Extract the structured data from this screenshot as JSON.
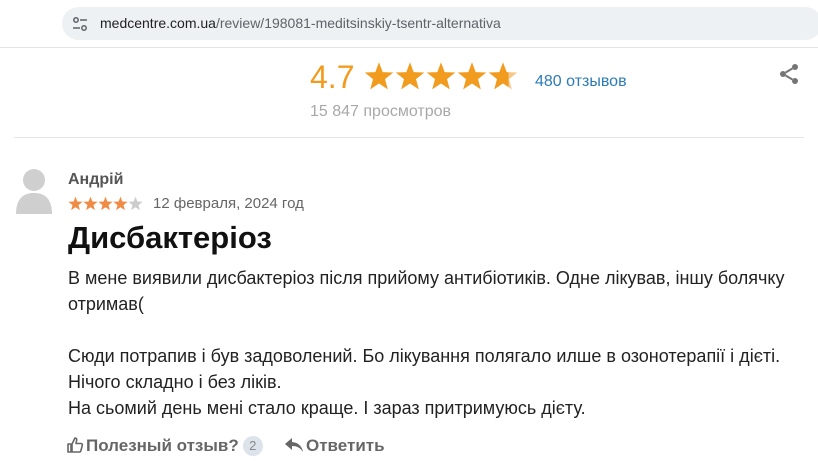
{
  "browser": {
    "url_domain": "medcentre.com.ua",
    "url_path": "/review/198081-meditsinskiy-tsentr-alternativa"
  },
  "rating": {
    "score": "4.7",
    "stars_filled": 4.7,
    "reviews_link": "480 отзывов",
    "views": "15 847 просмотров",
    "star_color": "#f29c1f"
  },
  "review": {
    "author": "Андрій",
    "stars_filled": 4,
    "star_color": "#ef8b44",
    "date": "12 февраля, 2024 год",
    "title": "Дисбактеріоз",
    "paragraphs": [
      "В мене виявили дисбактеріоз після прийому антибіотиків. Одне лікував, іншу болячку отримав(",
      "",
      "Сюди потрапив і був задоволений. Бо лікування полягало илше в озонотерапії і дієті.",
      "Нічого складно і без ліків.",
      "На сьомий день мені стало краще. І зараз притримуюсь дієту."
    ],
    "helpful_label": "Полезный отзыв?",
    "helpful_count": "2",
    "reply_label": "Ответить"
  },
  "icons": {
    "site_settings": "tune-icon",
    "share": "share-icon",
    "avatar": "user-silhouette-icon",
    "helpful": "thumbs-up-icon",
    "reply": "reply-arrow-icon"
  }
}
